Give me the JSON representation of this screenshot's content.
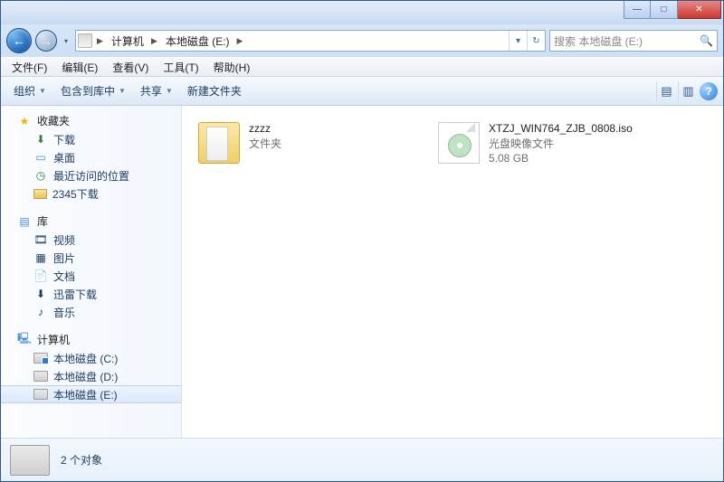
{
  "titlebar": {
    "min_glyph": "—",
    "max_glyph": "□",
    "close_glyph": "✕"
  },
  "nav": {
    "back_glyph": "←",
    "fwd_glyph": "→"
  },
  "address": {
    "seg1": "计算机",
    "seg2": "本地磁盘 (E:)",
    "arrow": "▶",
    "dd_glyph": "▾",
    "refresh_glyph": "↻"
  },
  "search": {
    "placeholder": "搜索 本地磁盘 (E:)",
    "icon": "🔍"
  },
  "menu": {
    "file": "文件(F)",
    "edit": "编辑(E)",
    "view": "查看(V)",
    "tools": "工具(T)",
    "help": "帮助(H)"
  },
  "toolbar": {
    "organize": "组织",
    "include": "包含到库中",
    "share": "共享",
    "newfolder": "新建文件夹",
    "view_glyph": "▤",
    "preview_glyph": "▥",
    "help_glyph": "?"
  },
  "sidebar": {
    "favorites": {
      "label": "收藏夹",
      "items": {
        "downloads": "下载",
        "desktop": "桌面",
        "recent": "最近访问的位置",
        "dl2345": "2345下载"
      }
    },
    "libraries": {
      "label": "库",
      "items": {
        "video": "视频",
        "pictures": "图片",
        "documents": "文档",
        "xunlei": "迅雷下载",
        "music": "音乐"
      }
    },
    "computer": {
      "label": "计算机",
      "items": {
        "c": "本地磁盘 (C:)",
        "d": "本地磁盘 (D:)",
        "e": "本地磁盘 (E:)"
      }
    }
  },
  "files": {
    "folder1": {
      "name": "zzzz",
      "type": "文件夹"
    },
    "iso1": {
      "name": "XTZJ_WIN764_ZJB_0808.iso",
      "type": "光盘映像文件",
      "size": "5.08 GB"
    }
  },
  "details": {
    "summary": "2 个对象"
  }
}
